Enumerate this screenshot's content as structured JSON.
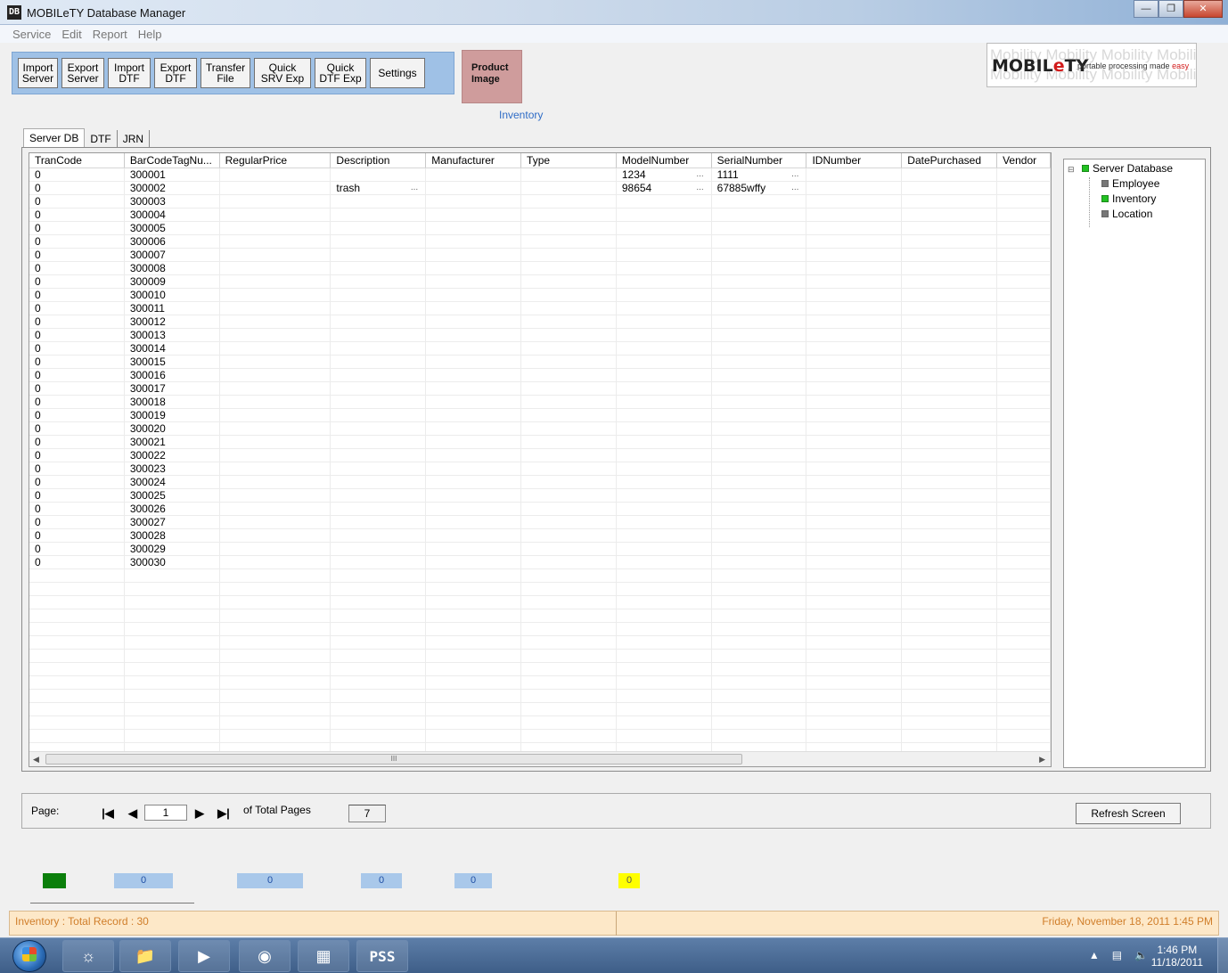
{
  "window": {
    "title": "MOBILeTY Database Manager",
    "app_icon": "DB"
  },
  "menu": [
    "Service",
    "Edit",
    "Report",
    "Help"
  ],
  "toolbar": {
    "buttons": [
      {
        "label": "Import\nServer"
      },
      {
        "label": "Export\nServer"
      },
      {
        "label": "Import\nDTF"
      },
      {
        "label": "Export\nDTF"
      },
      {
        "label": "Transfer\nFile"
      },
      {
        "label": "Quick\nSRV Exp"
      },
      {
        "label": "Quick\nDTF Exp"
      },
      {
        "label": "Settings"
      }
    ],
    "product_image_label": "Product\nImage",
    "section_label": "Inventory"
  },
  "logo": {
    "background_text": "Mobility Mobility Mobility Mobility",
    "brand_prefix": "MOBIL",
    "brand_e": "e",
    "brand_suffix": "TY",
    "tagline_main": "portable processing made ",
    "tagline_accent": "easy"
  },
  "tabs": [
    {
      "label": "Server DB",
      "active": true
    },
    {
      "label": "DTF",
      "active": false
    },
    {
      "label": "JRN",
      "active": false
    }
  ],
  "grid": {
    "columns": [
      "TranCode",
      "BarCodeTagNu...",
      "RegularPrice",
      "Description",
      "Manufacturer",
      "Type",
      "ModelNumber",
      "SerialNumber",
      "IDNumber",
      "DatePurchased",
      "Vendor"
    ],
    "rows": [
      {
        "trancode": "0",
        "barcode": "300001",
        "description": "",
        "model": "1234",
        "serial": "1111"
      },
      {
        "trancode": "0",
        "barcode": "300002",
        "description": "trash",
        "model": "98654",
        "serial": "67885wffy"
      },
      {
        "trancode": "0",
        "barcode": "300003"
      },
      {
        "trancode": "0",
        "barcode": "300004"
      },
      {
        "trancode": "0",
        "barcode": "300005"
      },
      {
        "trancode": "0",
        "barcode": "300006"
      },
      {
        "trancode": "0",
        "barcode": "300007"
      },
      {
        "trancode": "0",
        "barcode": "300008"
      },
      {
        "trancode": "0",
        "barcode": "300009"
      },
      {
        "trancode": "0",
        "barcode": "300010"
      },
      {
        "trancode": "0",
        "barcode": "300011"
      },
      {
        "trancode": "0",
        "barcode": "300012"
      },
      {
        "trancode": "0",
        "barcode": "300013"
      },
      {
        "trancode": "0",
        "barcode": "300014"
      },
      {
        "trancode": "0",
        "barcode": "300015"
      },
      {
        "trancode": "0",
        "barcode": "300016"
      },
      {
        "trancode": "0",
        "barcode": "300017"
      },
      {
        "trancode": "0",
        "barcode": "300018"
      },
      {
        "trancode": "0",
        "barcode": "300019"
      },
      {
        "trancode": "0",
        "barcode": "300020"
      },
      {
        "trancode": "0",
        "barcode": "300021"
      },
      {
        "trancode": "0",
        "barcode": "300022"
      },
      {
        "trancode": "0",
        "barcode": "300023"
      },
      {
        "trancode": "0",
        "barcode": "300024"
      },
      {
        "trancode": "0",
        "barcode": "300025"
      },
      {
        "trancode": "0",
        "barcode": "300026"
      },
      {
        "trancode": "0",
        "barcode": "300027"
      },
      {
        "trancode": "0",
        "barcode": "300028"
      },
      {
        "trancode": "0",
        "barcode": "300029"
      },
      {
        "trancode": "0",
        "barcode": "300030"
      }
    ],
    "ellipsis": "...",
    "scroll_thumb_grip": "III"
  },
  "tree": {
    "root": "Server Database",
    "children": [
      {
        "label": "Employee",
        "status": "grey"
      },
      {
        "label": "Inventory",
        "status": "green"
      },
      {
        "label": "Location",
        "status": "grey"
      }
    ]
  },
  "pager": {
    "page_label": "Page:",
    "current_page": "1",
    "of_total_label": "of Total Pages",
    "total_pages": "7",
    "refresh_label": "Refresh Screen"
  },
  "indicators": {
    "counts": [
      "0",
      "0",
      "0",
      "0"
    ],
    "yellow_count": "0",
    "colors": {
      "green": "#0b7f0b",
      "blue": "#a9c8ea",
      "yellow": "#ffff00"
    }
  },
  "status": {
    "left": "Inventory :  Total Record : 30",
    "right": "Friday, November 18, 2011 1:45 PM"
  },
  "taskbar": {
    "time": "1:46 PM",
    "date": "11/18/2011",
    "apps": [
      "internet-explorer-icon",
      "file-explorer-icon",
      "media-player-icon",
      "green-disc-app-icon",
      "terminal-app-icon",
      "pss-app-icon"
    ],
    "pss_label": "PSS"
  }
}
